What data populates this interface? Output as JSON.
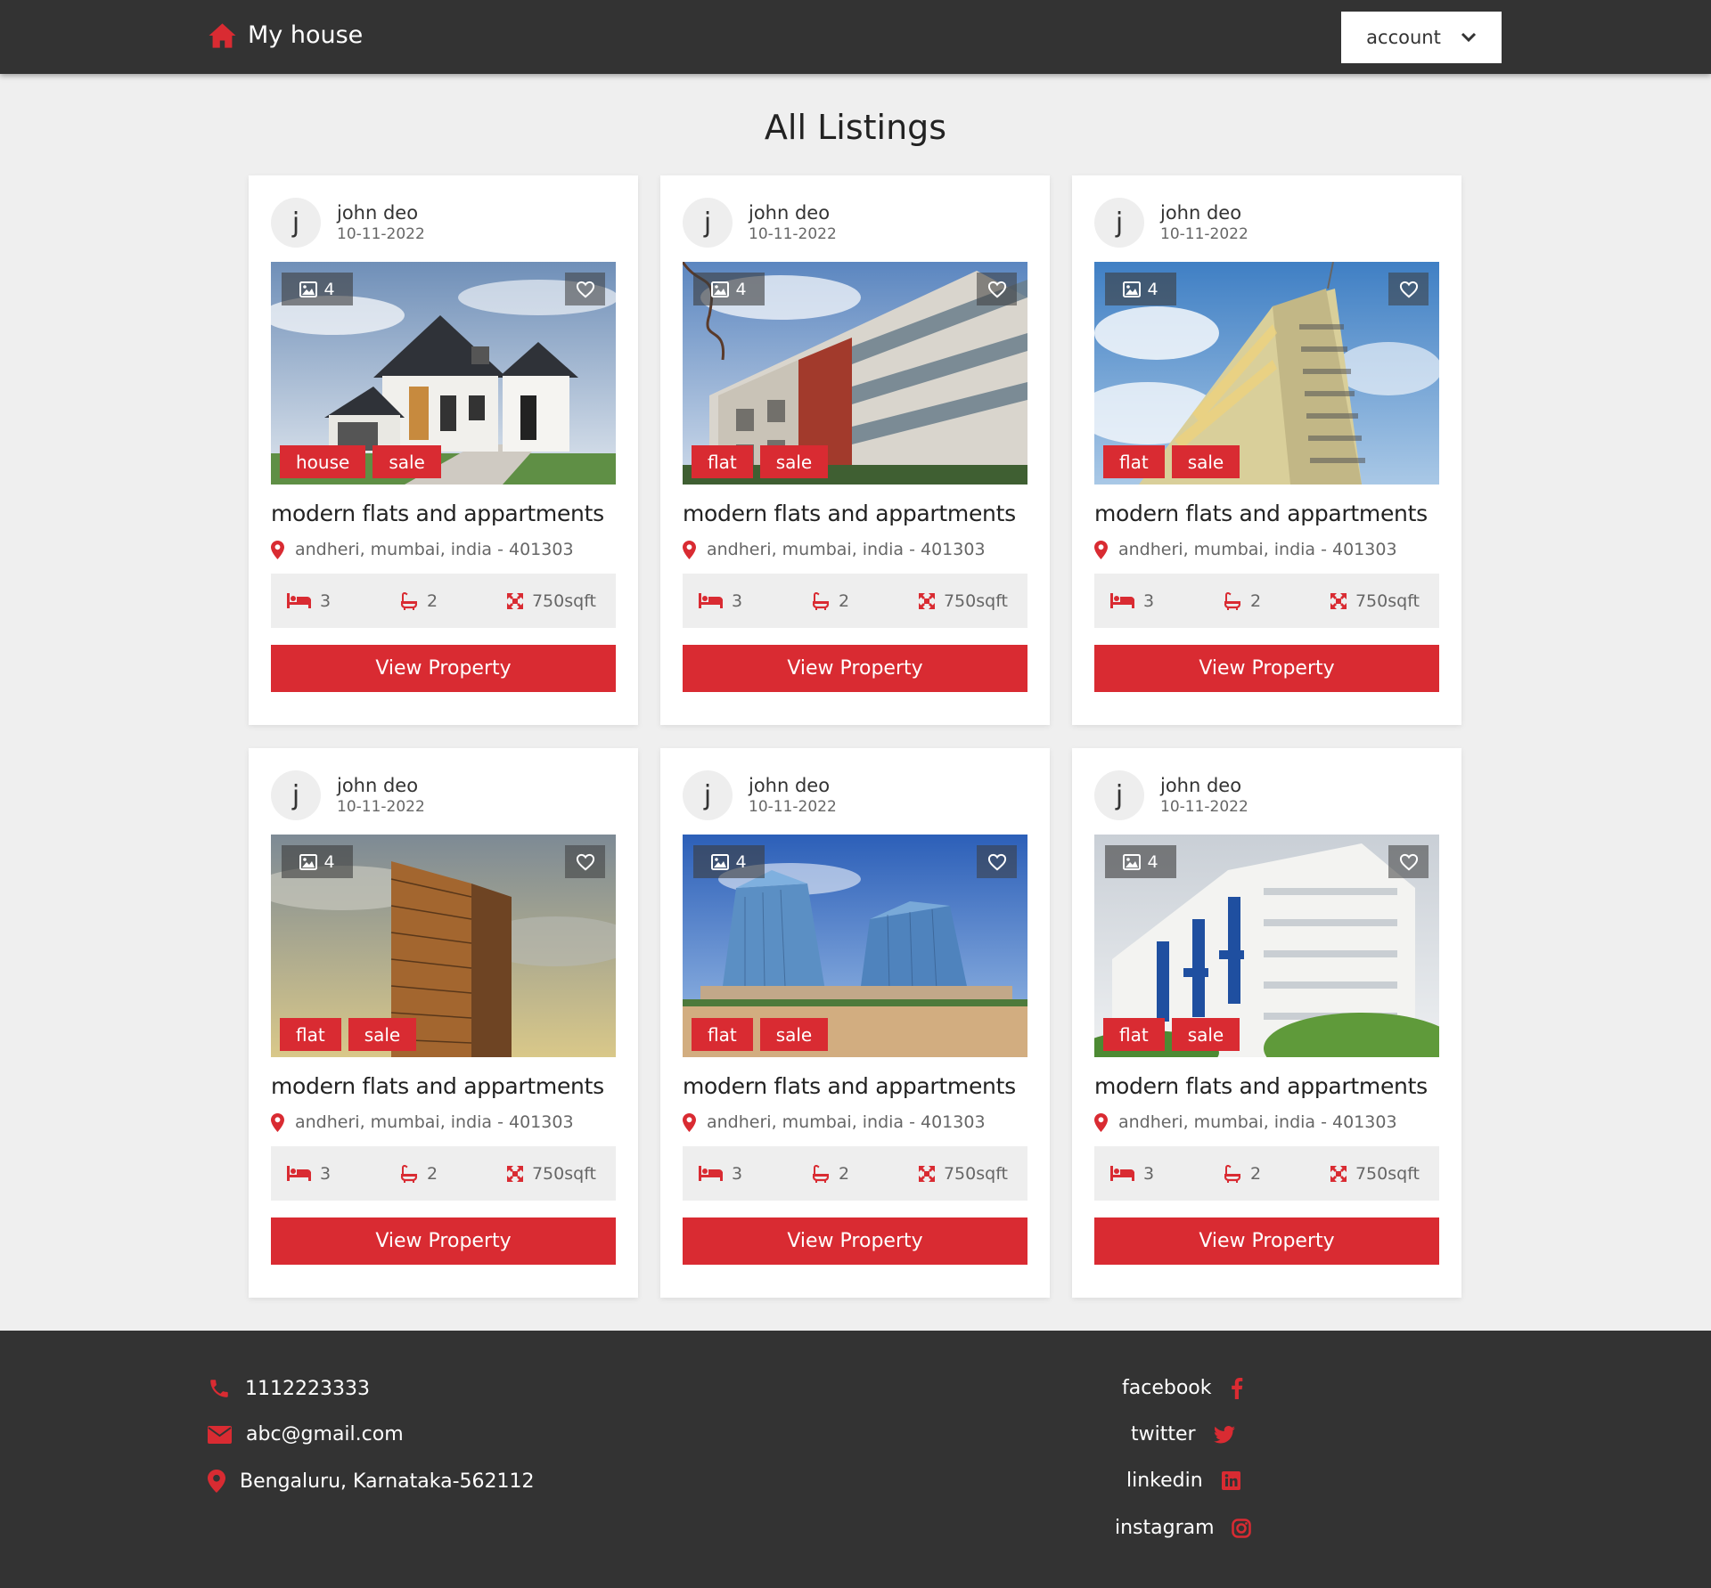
{
  "header": {
    "brand": "My house",
    "account_label": "account"
  },
  "page": {
    "title": "All Listings"
  },
  "listings": [
    {
      "author_initial": "j",
      "author": "john deo",
      "date": "10-11-2022",
      "photo_count": "4",
      "tags": [
        "house",
        "sale"
      ],
      "title": "modern flats and appartments",
      "address": "andheri, mumbai, india - 401303",
      "beds": "3",
      "baths": "2",
      "area": "750sqft",
      "cta": "View Property",
      "image": "suburban-house"
    },
    {
      "author_initial": "j",
      "author": "john deo",
      "date": "10-11-2022",
      "photo_count": "4",
      "tags": [
        "flat",
        "sale"
      ],
      "title": "modern flats and appartments",
      "address": "andheri, mumbai, india - 401303",
      "beds": "3",
      "baths": "2",
      "area": "750sqft",
      "cta": "View Property",
      "image": "modern-apartment-block"
    },
    {
      "author_initial": "j",
      "author": "john deo",
      "date": "10-11-2022",
      "photo_count": "4",
      "tags": [
        "flat",
        "sale"
      ],
      "title": "modern flats and appartments",
      "address": "andheri, mumbai, india - 401303",
      "beds": "3",
      "baths": "2",
      "area": "750sqft",
      "cta": "View Property",
      "image": "tall-tower-sky"
    },
    {
      "author_initial": "j",
      "author": "john deo",
      "date": "10-11-2022",
      "photo_count": "4",
      "tags": [
        "flat",
        "sale"
      ],
      "title": "modern flats and appartments",
      "address": "andheri, mumbai, india - 401303",
      "beds": "3",
      "baths": "2",
      "area": "750sqft",
      "cta": "View Property",
      "image": "brown-highrise"
    },
    {
      "author_initial": "j",
      "author": "john deo",
      "date": "10-11-2022",
      "photo_count": "4",
      "tags": [
        "flat",
        "sale"
      ],
      "title": "modern flats and appartments",
      "address": "andheri, mumbai, india - 401303",
      "beds": "3",
      "baths": "2",
      "area": "750sqft",
      "cta": "View Property",
      "image": "glass-towers"
    },
    {
      "author_initial": "j",
      "author": "john deo",
      "date": "10-11-2022",
      "photo_count": "4",
      "tags": [
        "flat",
        "sale"
      ],
      "title": "modern flats and appartments",
      "address": "andheri, mumbai, india - 401303",
      "beds": "3",
      "baths": "2",
      "area": "750sqft",
      "cta": "View Property",
      "image": "white-blue-apartments"
    }
  ],
  "footer": {
    "contact": {
      "phone": "1112223333",
      "email": "abc@gmail.com",
      "location": "Bengaluru, Karnataka-562112"
    },
    "social": {
      "facebook": "facebook",
      "twitter": "twitter",
      "linkedin": "linkedin",
      "instagram": "instagram"
    }
  },
  "colors": {
    "accent": "#d92b32",
    "header_bg": "#333333",
    "page_bg": "#efefef",
    "card_bg": "#ffffff",
    "stats_bg": "#eeeeee"
  },
  "icons": {
    "brand": "home-icon",
    "account": "chevron-down-icon",
    "photo_count": "image-icon",
    "favorite": "heart-icon",
    "address": "map-pin-icon",
    "beds": "bed-icon",
    "baths": "bath-icon",
    "area": "expand-icon",
    "phone": "phone-icon",
    "email": "envelope-icon",
    "location": "map-pin-icon",
    "facebook": "facebook-icon",
    "twitter": "twitter-icon",
    "linkedin": "linkedin-icon",
    "instagram": "instagram-icon"
  }
}
